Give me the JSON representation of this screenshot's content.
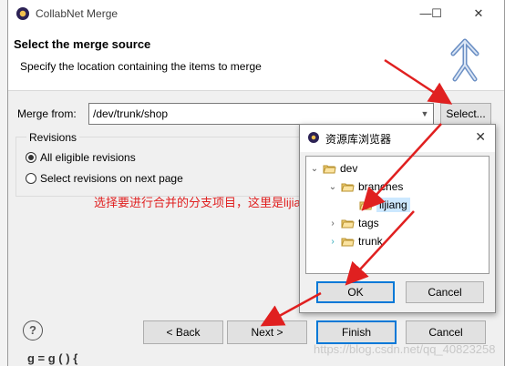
{
  "window": {
    "title": "CollabNet Merge",
    "controls": [
      "—",
      "☐",
      "✕"
    ]
  },
  "header": {
    "title": "Select the merge source",
    "description": "Specify the location containing the items to merge"
  },
  "merge_from": {
    "label": "Merge from:",
    "value": "/dev/trunk/shop",
    "select_button": "Select..."
  },
  "revisions": {
    "group_title": "Revisions",
    "options": [
      {
        "label": "All eligible revisions",
        "selected": true
      },
      {
        "label": "Select revisions on next page",
        "selected": false
      }
    ]
  },
  "footer": {
    "help": "?",
    "back": "< Back",
    "next": "Next >",
    "finish": "Finish",
    "cancel": "Cancel"
  },
  "browser_dialog": {
    "title": "资源库浏览器",
    "close": "✕",
    "tree": [
      {
        "label": "dev",
        "expanded": true
      },
      {
        "label": "branches",
        "expanded": true
      },
      {
        "label": "lijiang",
        "selected": true
      },
      {
        "label": "tags",
        "expanded": false
      },
      {
        "label": "trunk",
        "expanded": false
      }
    ],
    "ok": "OK",
    "cancel": "Cancel"
  },
  "annotation": {
    "text": "选择要进行合并的分支项目，这里是lijiang"
  },
  "watermark": "https://blog.csdn.net/qq_40823258",
  "background_code": "g = g ( )  {",
  "colors": {
    "annotation_red": "#e02020",
    "selection_blue": "#cce8ff",
    "primary_border": "#0078d7"
  }
}
